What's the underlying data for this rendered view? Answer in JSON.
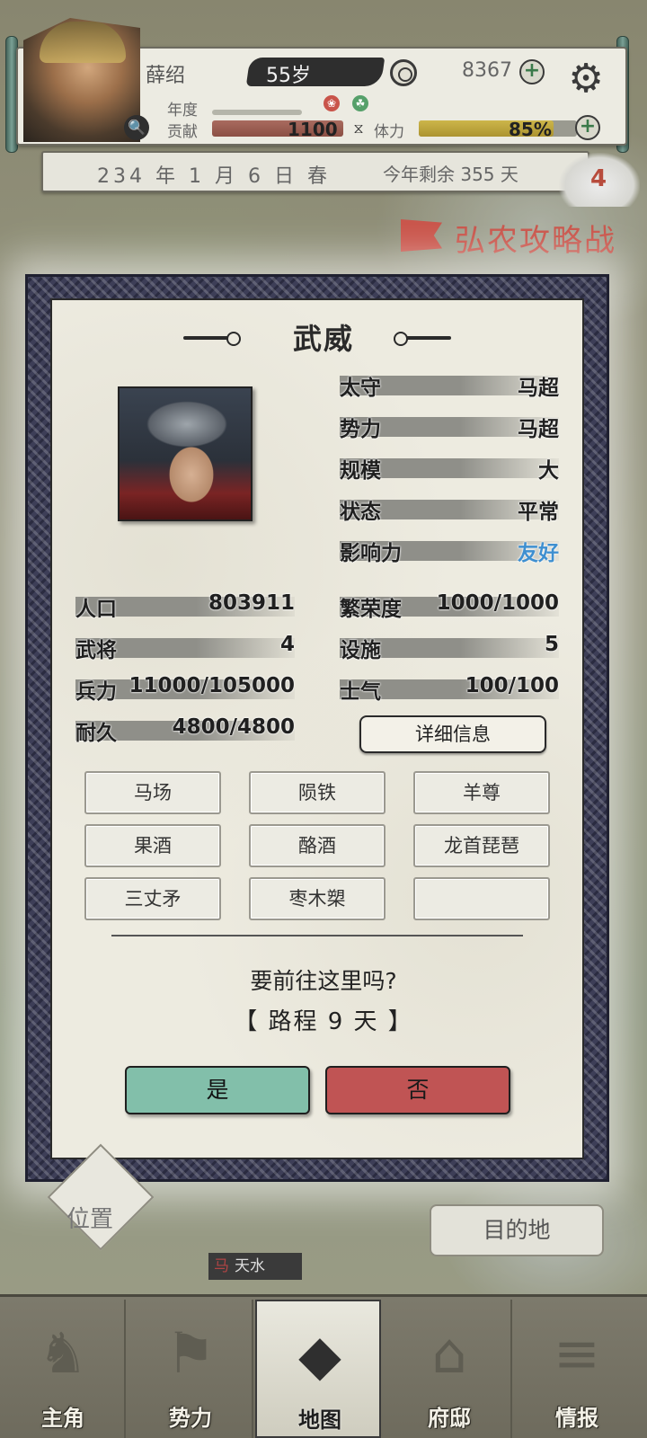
{
  "player": {
    "name": "薛绍",
    "age": "55岁",
    "gold": "8367",
    "year_label": "年度",
    "contribution_label": "贡献",
    "contribution_value": "1100",
    "stamina_label": "体力",
    "stamina_value": "85%",
    "stamina_fraction": 0.85
  },
  "calendar": {
    "date": "234 年 1 月 6 日 春",
    "remaining": "今年剩余 355 天",
    "badge_count": "4"
  },
  "campaign": {
    "title": "弘农攻略战"
  },
  "city": {
    "name": "武威",
    "info": [
      {
        "label": "太守",
        "value": "马超"
      },
      {
        "label": "势力",
        "value": "马超"
      },
      {
        "label": "规模",
        "value": "大"
      },
      {
        "label": "状态",
        "value": "平常"
      },
      {
        "label": "影响力",
        "value": "友好"
      }
    ],
    "stats_left": [
      {
        "label": "人口",
        "value": "803911"
      },
      {
        "label": "武将",
        "value": "4"
      },
      {
        "label": "兵力",
        "value": "11000/105000"
      },
      {
        "label": "耐久",
        "value": "4800/4800"
      }
    ],
    "stats_right": [
      {
        "label": "繁荣度",
        "value": "1000/1000"
      },
      {
        "label": "设施",
        "value": "5"
      },
      {
        "label": "士气",
        "value": "100/100"
      }
    ],
    "detail_button": "详细信息",
    "specialties": [
      "马场",
      "陨铁",
      "羊尊",
      "果酒",
      "酪酒",
      "龙首琵琶",
      "三丈矛",
      "枣木槊",
      ""
    ]
  },
  "dialog": {
    "question": "要前往这里吗?",
    "route": "【 路程 9 天 】",
    "yes": "是",
    "no": "否"
  },
  "map": {
    "location_button": "位置",
    "destination_button": "目的地",
    "city_tag_mark": "马",
    "city_tag_name": "天水"
  },
  "nav": [
    {
      "label": "主角",
      "icon": "hero-icon"
    },
    {
      "label": "势力",
      "icon": "flag-icon"
    },
    {
      "label": "地图",
      "icon": "map-icon"
    },
    {
      "label": "府邸",
      "icon": "mansion-icon"
    },
    {
      "label": "情报",
      "icon": "scroll-icon"
    }
  ],
  "colors": {
    "friendly": "#3e8fd0",
    "yes_button": "#82bfaa",
    "no_button": "#c05454",
    "campaign": "#c9544a"
  }
}
